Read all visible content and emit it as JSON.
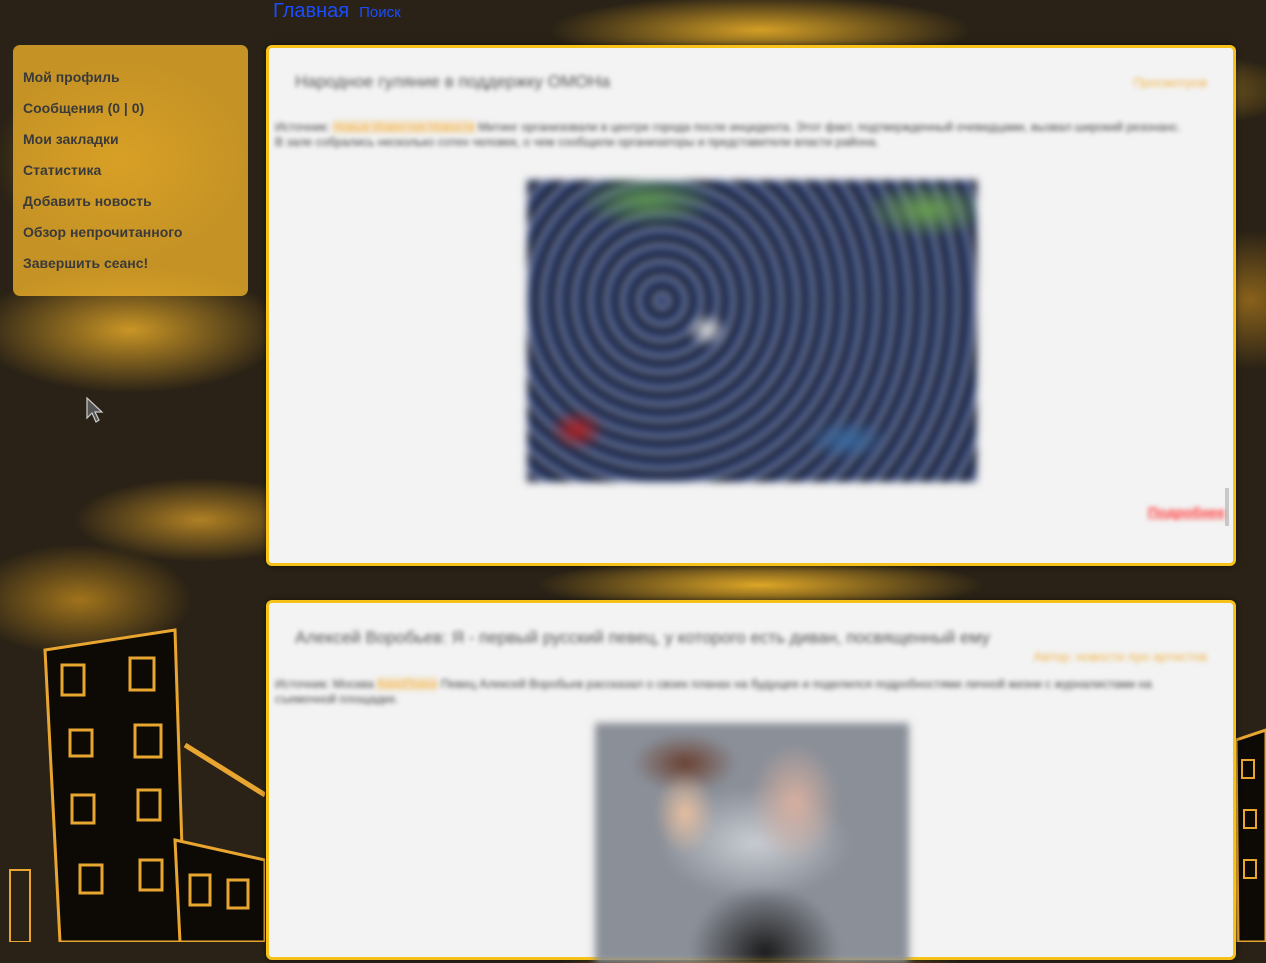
{
  "topnav": {
    "home": "Главная",
    "search": "Поиск"
  },
  "sidebar": {
    "items": [
      {
        "label": "Мой профиль"
      },
      {
        "label": "Сообщения (0 | 0)"
      },
      {
        "label": "Мои закладки"
      },
      {
        "label": "Статистика"
      },
      {
        "label": "Добавить новость"
      },
      {
        "label": "Обзор непрочитанного"
      },
      {
        "label": "Завершить сеанс!"
      }
    ]
  },
  "posts": [
    {
      "title": "Народное гуляние в поддержку ОМОНа",
      "meta": "Просмотров",
      "text_prefix": "Источник:",
      "text_link": "Новые Известия Новости",
      "text_body": "Митинг организовали в центре города после инцидента. Этот факт, подтвержденный очевидцами, вызвал широкий резонанс. В зале собрались несколько сотен человек, о чем сообщили организаторы и представители власти района.",
      "more_label": "Подробнее",
      "photo_icon": "crowd-photo"
    },
    {
      "title": "Алексей Воробьев: Я - первый русский певец, у которого есть диван, посвященный ему",
      "meta": "Автор: новости про артистов",
      "text_prefix": "Источник: Москва",
      "text_link": "КиноПоиск",
      "text_body": "Певец Алексей Воробьев рассказал о своих планах на будущее и поделился подробностями личной жизни с журналистами на съемочной площадке.",
      "photo_icon": "singer-portrait-photo"
    }
  ],
  "colors": {
    "accent": "#f6c21a",
    "link": "#1a4dff",
    "more": "#ff3b3b",
    "sidebar_bg": "#e8ac28"
  }
}
